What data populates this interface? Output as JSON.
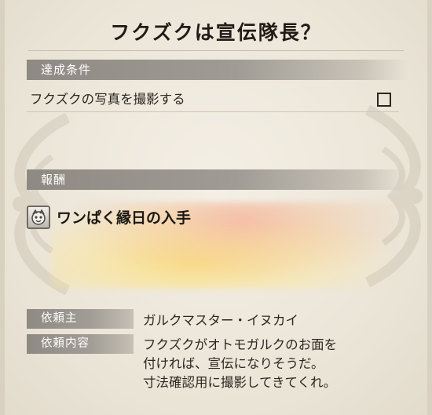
{
  "quest": {
    "title": "フクズクは宣伝隊長？"
  },
  "condition": {
    "header": "達成条件",
    "text": "フクズクの写真を撮影する",
    "completed": false
  },
  "reward": {
    "header": "報酬",
    "icon": "mask-item-icon",
    "item": "ワンぱく縁日の入手"
  },
  "client": {
    "label": "依頼主",
    "value": "ガルクマスター・イヌカイ"
  },
  "request": {
    "label": "依頼内容",
    "lines": [
      "フクズクがオトモガルクのお面を",
      "付ければ、宣伝になりそうだ。",
      "寸法確認用に撮影してきてくれ。"
    ]
  },
  "colors": {
    "section_bar": "#8e8a83",
    "background": "#ece6d9",
    "reward_highlight": "#fcdc6e"
  }
}
